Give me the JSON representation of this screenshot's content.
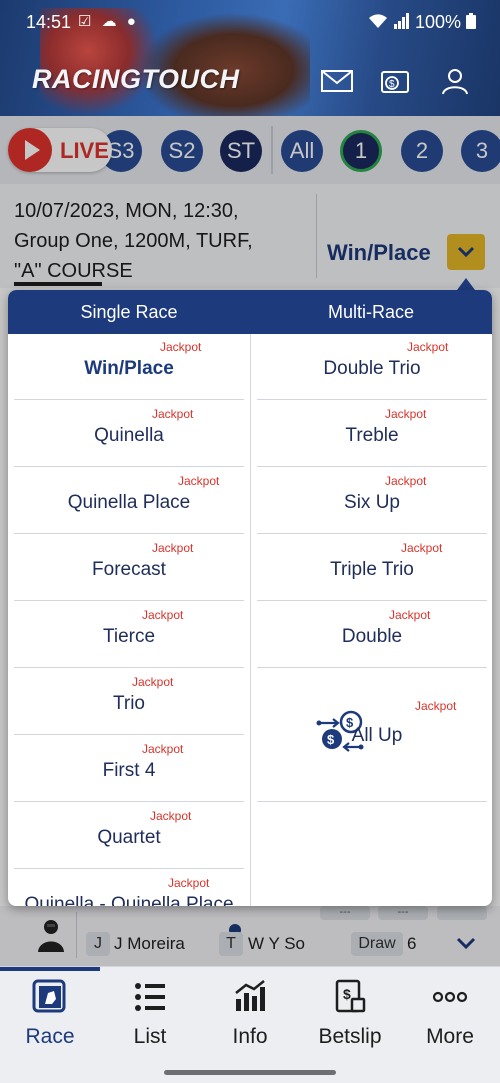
{
  "status_bar": {
    "time": "14:51",
    "notification_icons": "☑ ☁ ●",
    "battery": "100%"
  },
  "header": {
    "brand": "RACINGTOUCH",
    "icons": [
      "mail-icon",
      "wallet-icon",
      "user-icon"
    ]
  },
  "race_selector": {
    "live_label": "LIVE",
    "chips": [
      "S3",
      "S2",
      "ST",
      "All",
      "1",
      "2",
      "3"
    ],
    "selected": "1"
  },
  "race_info": {
    "line1": "10/07/2023, MON, 12:30,",
    "line2": "Group One, 1200M, TURF,",
    "line3": "\"A\" COURSE"
  },
  "pool_selector": {
    "current": "Win/Place"
  },
  "dropdown": {
    "single_header": "Single Race",
    "multi_header": "Multi-Race",
    "jackpot_label": "Jackpot",
    "single": [
      {
        "label": "Win/Place"
      },
      {
        "label": "Quinella"
      },
      {
        "label": "Quinella Place"
      },
      {
        "label": "Forecast"
      },
      {
        "label": "Tierce"
      },
      {
        "label": "Trio"
      },
      {
        "label": "First 4"
      },
      {
        "label": "Quartet"
      },
      {
        "label": "Quinella - Quinella Place"
      }
    ],
    "multi": [
      {
        "label": "Double Trio"
      },
      {
        "label": "Treble"
      },
      {
        "label": "Six Up"
      },
      {
        "label": "Triple Trio"
      },
      {
        "label": "Double"
      },
      {
        "label": "All Up"
      }
    ]
  },
  "runner": {
    "placeholders": [
      "---",
      "---"
    ],
    "jockey_tag": "J",
    "jockey": "J Moreira",
    "trainer_tag": "T",
    "trainer": "W Y So",
    "draw_label": "Draw",
    "draw": "6"
  },
  "tabs": [
    {
      "label": "Race",
      "icon": "race-icon"
    },
    {
      "label": "List",
      "icon": "list-icon"
    },
    {
      "label": "Info",
      "icon": "info-chart-icon"
    },
    {
      "label": "Betslip",
      "icon": "betslip-icon"
    },
    {
      "label": "More",
      "icon": "more-icon"
    }
  ],
  "colors": {
    "brand_navy": "#1d3a7c",
    "live_red": "#e0322c",
    "jackpot_red": "#d9342b",
    "pool_button": "#e5b728",
    "selected_ring": "#2fa84f"
  }
}
